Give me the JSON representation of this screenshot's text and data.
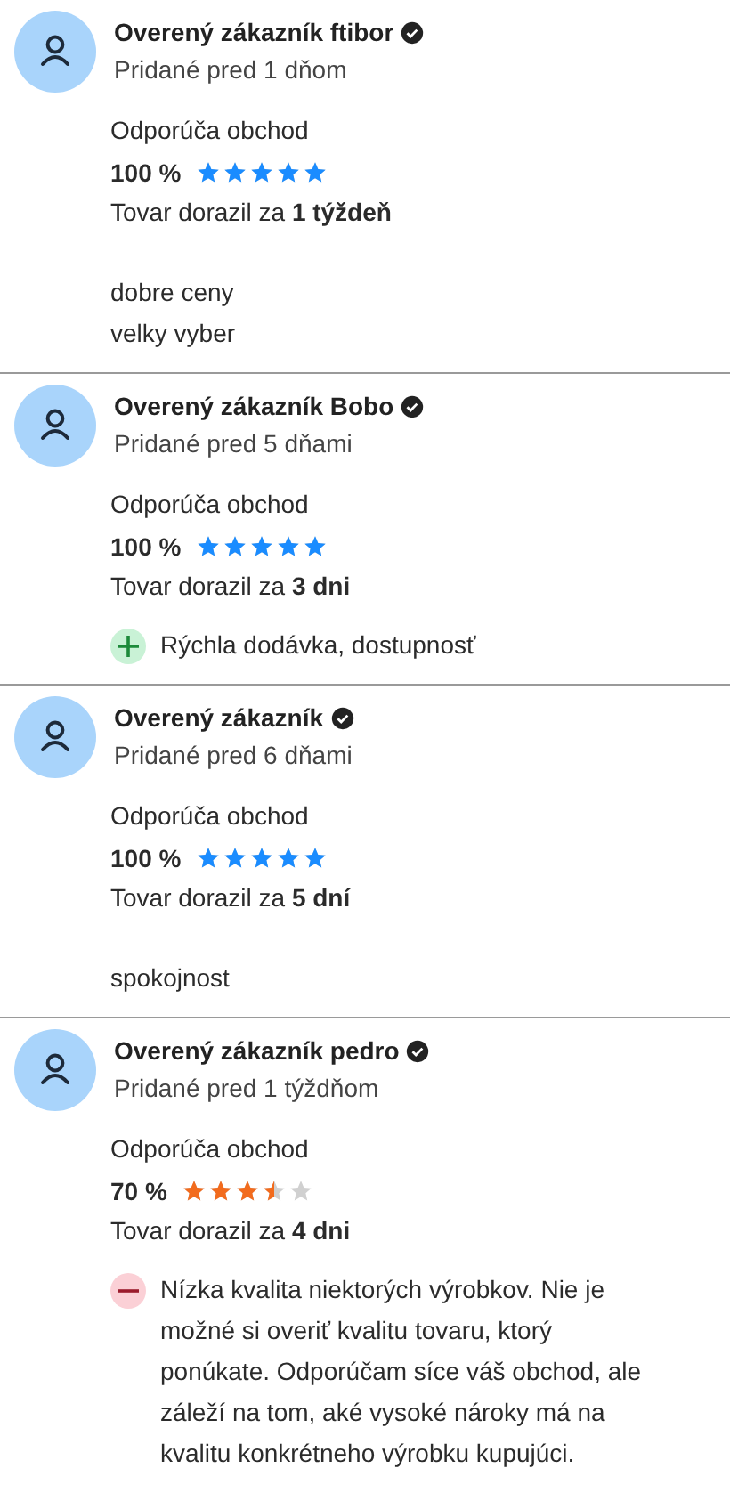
{
  "reviews": [
    {
      "name": "Overený zákazník ftibor",
      "verified": true,
      "added": "Pridané pred 1 dňom",
      "recommends_label": "Odporúča obchod",
      "percent": "100 %",
      "stars": 5,
      "delivery": "Tovar dorazil za **1 týždeň**",
      "comment_lines": [
        "dobre ceny",
        "velky vyber"
      ]
    },
    {
      "name": "Overený zákazník Bobo",
      "verified": true,
      "added": "Pridané pred 5 dňami",
      "recommends_label": "Odporúča obchod",
      "percent": "100 %",
      "stars": 5,
      "delivery": "Tovar dorazil za **3 dni**",
      "points": [
        {
          "kind": "pro",
          "text": "Rýchla dodávka, dostupnosť"
        }
      ]
    },
    {
      "name": "Overený zákazník",
      "verified": true,
      "added": "Pridané pred 6 dňami",
      "recommends_label": "Odporúča obchod",
      "percent": "100 %",
      "stars": 5,
      "delivery": "Tovar dorazil za **5 dní**",
      "comment_lines": [
        "spokojnost"
      ]
    },
    {
      "name": "Overený zákazník pedro",
      "verified": true,
      "added": "Pridané pred 1 týždňom",
      "recommends_label": "Odporúča obchod",
      "percent": "70 %",
      "stars": 3.5,
      "delivery": "Tovar dorazil za **4 dni**",
      "points": [
        {
          "kind": "con",
          "text": "Nízka kvalita niektorých výrobkov. Nie je možné si overiť kvalitu tovaru, ktorý ponúkate. Odporúčam síce váš obchod, ale záleží na tom, aké vysoké nároky má na kvalitu konkrétneho výrobku kupujúci."
        }
      ]
    }
  ]
}
